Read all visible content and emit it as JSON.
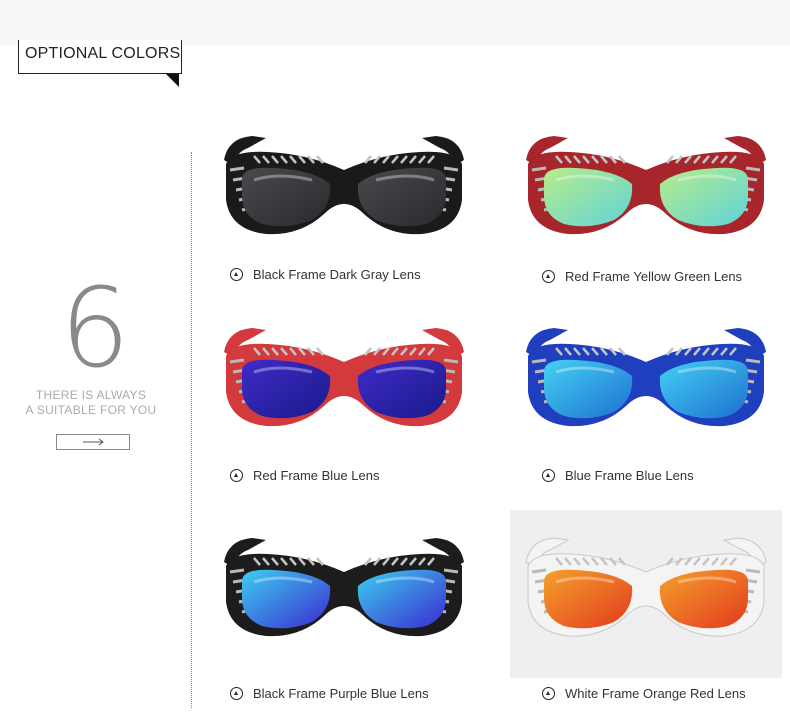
{
  "heading": "OPTIONAL COLORS",
  "side_panel": {
    "number": "6",
    "tagline_line1": "THERE IS ALWAYS",
    "tagline_line2": "A SUITABLE FOR YOU",
    "arrow": "→"
  },
  "products": [
    {
      "caption": "Black Frame Dark Gray Lens",
      "frame_color": "#1a1a1a",
      "lens_color": "#4a4a4e",
      "lens_tint": "#2a2a2e"
    },
    {
      "caption": "Red Frame Yellow Green Lens",
      "frame_color": "#a7262b",
      "lens_color": "#b8ec8a",
      "lens_tint": "#5fd3d9"
    },
    {
      "caption": "Red Frame Blue Lens",
      "frame_color": "#d23a3d",
      "lens_color": "#3f2bc9",
      "lens_tint": "#1a1a8a"
    },
    {
      "caption": "Blue Frame Blue Lens",
      "frame_color": "#1f3fbf",
      "lens_color": "#44d2f3",
      "lens_tint": "#1e6fd0"
    },
    {
      "caption": "Black Frame Purple Blue Lens",
      "frame_color": "#1c1c1c",
      "lens_color": "#3ccff0",
      "lens_tint": "#3b2ad0"
    },
    {
      "caption": "White Frame Orange Red Lens",
      "frame_color": "#f4f4f4",
      "lens_color": "#f5a12a",
      "lens_tint": "#e23a1f"
    }
  ]
}
